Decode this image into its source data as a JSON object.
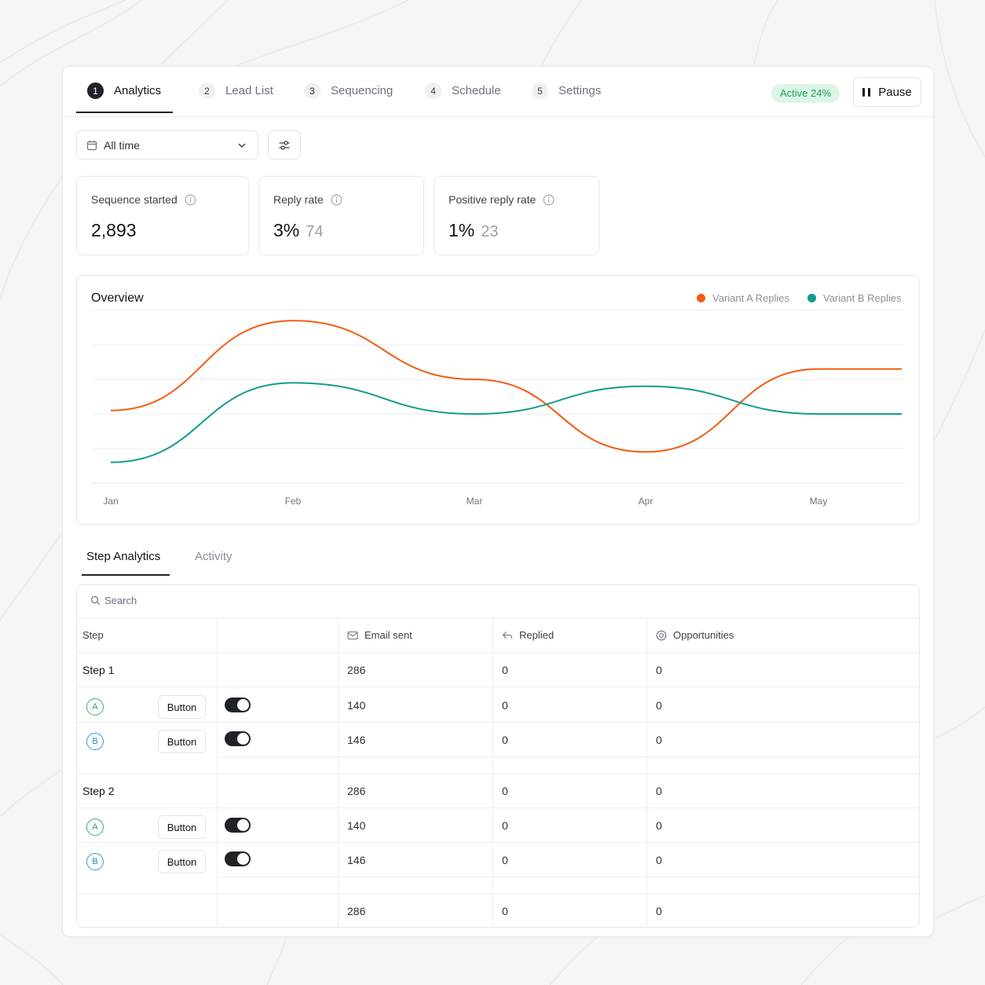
{
  "tabs": [
    {
      "num": "1",
      "label": "Analytics",
      "active": true
    },
    {
      "num": "2",
      "label": "Lead List",
      "active": false
    },
    {
      "num": "3",
      "label": "Sequencing",
      "active": false
    },
    {
      "num": "4",
      "label": "Schedule",
      "active": false
    },
    {
      "num": "5",
      "label": "Settings",
      "active": false
    }
  ],
  "status_badge": "Active 24%",
  "pause_label": "Pause",
  "date_filter": {
    "value": "All time"
  },
  "stats": [
    {
      "label": "Sequence started",
      "value": "2,893",
      "sub": ""
    },
    {
      "label": "Reply rate",
      "value": "3%",
      "sub": "74"
    },
    {
      "label": "Positive reply rate",
      "value": "1%",
      "sub": "23"
    }
  ],
  "overview": {
    "title": "Overview",
    "colors": {
      "variant_a": "#f25c12",
      "variant_b": "#129c8c"
    }
  },
  "chart_data": {
    "type": "line",
    "title": "Overview",
    "x": [
      "Jan",
      "Feb",
      "Mar",
      "Apr",
      "May"
    ],
    "series": [
      {
        "name": "Variant A Replies",
        "values": [
          2.1,
          4.7,
          3.0,
          0.9,
          3.3
        ]
      },
      {
        "name": "Variant B Replies",
        "values": [
          0.6,
          2.9,
          2.0,
          2.8,
          2.0
        ]
      }
    ],
    "ylim": [
      0,
      5
    ],
    "grid": true,
    "legend": "top-right"
  },
  "subtabs": {
    "step_analytics": "Step Analytics",
    "activity": "Activity"
  },
  "table": {
    "search_placeholder": "Search",
    "headers": {
      "step": "Step",
      "email_sent": "Email sent",
      "replied": "Replied",
      "opportunities": "Opportunities"
    },
    "steps": [
      {
        "name": "Step 1",
        "email_sent": "286",
        "replied": "0",
        "opportunities": "0",
        "variants": [
          {
            "letter": "A",
            "button": "Button",
            "email_sent": "140",
            "replied": "0",
            "opportunities": "0"
          },
          {
            "letter": "B",
            "button": "Button",
            "email_sent": "146",
            "replied": "0",
            "opportunities": "0"
          }
        ]
      },
      {
        "name": "Step 2",
        "email_sent": "286",
        "replied": "0",
        "opportunities": "0",
        "variants": [
          {
            "letter": "A",
            "button": "Button",
            "email_sent": "140",
            "replied": "0",
            "opportunities": "0"
          },
          {
            "letter": "B",
            "button": "Button",
            "email_sent": "146",
            "replied": "0",
            "opportunities": "0"
          }
        ]
      }
    ],
    "total": {
      "email_sent": "286",
      "replied": "0",
      "opportunities": "0"
    }
  }
}
